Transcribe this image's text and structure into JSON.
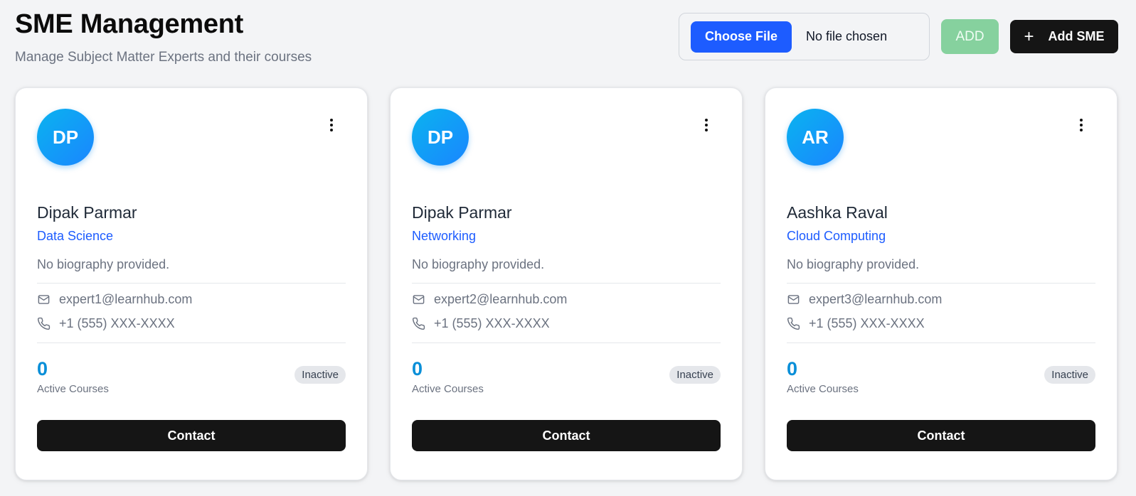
{
  "header": {
    "title": "SME Management",
    "subtitle": "Manage Subject Matter Experts and their courses"
  },
  "upload": {
    "choose_file_label": "Choose File",
    "file_status": "No file chosen",
    "add_label": "ADD"
  },
  "add_sme": {
    "icon": "plus-icon",
    "label": "Add SME"
  },
  "colors": {
    "accent": "#1d5cff",
    "add_button": "#86d19e",
    "course_count": "#0a8fd8",
    "dark_button": "#151515"
  },
  "cards": [
    {
      "initials": "DP",
      "name": "Dipak Parmar",
      "specialty": "Data Science",
      "bio": "No biography provided.",
      "email": "expert1@learnhub.com",
      "phone": "+1 (555) XXX-XXXX",
      "active_courses": "0",
      "active_courses_label": "Active Courses",
      "status": "Inactive",
      "contact_label": "Contact"
    },
    {
      "initials": "DP",
      "name": "Dipak Parmar",
      "specialty": "Networking",
      "bio": "No biography provided.",
      "email": "expert2@learnhub.com",
      "phone": "+1 (555) XXX-XXXX",
      "active_courses": "0",
      "active_courses_label": "Active Courses",
      "status": "Inactive",
      "contact_label": "Contact"
    },
    {
      "initials": "AR",
      "name": "Aashka Raval",
      "specialty": "Cloud Computing",
      "bio": "No biography provided.",
      "email": "expert3@learnhub.com",
      "phone": "+1 (555) XXX-XXXX",
      "active_courses": "0",
      "active_courses_label": "Active Courses",
      "status": "Inactive",
      "contact_label": "Contact"
    }
  ]
}
